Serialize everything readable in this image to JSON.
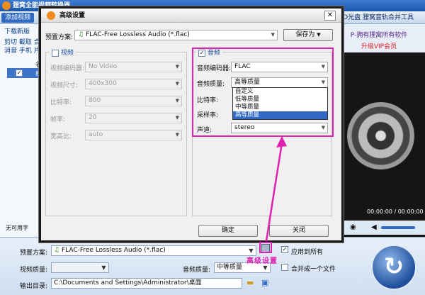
{
  "app": {
    "title": "狸窝全能视频转换器",
    "add_video": "添加视频",
    "right_toolbar": "VD光盘  狸窝音轨合并工具",
    "left_links": [
      "下载新版",
      "剪切 截取 合",
      "消音 手机 片"
    ],
    "list_header": "名",
    "list_item": "格",
    "ad_line1": "P-拥有狸窝所有软件",
    "ad_line2": "升级VIP会员",
    "time_display": "00:00:00 / 00:00:00",
    "no_subtitle": "无可用字"
  },
  "dialog": {
    "title": "高级设置",
    "preset_label": "预置方案:",
    "preset_value": "FLAC-Free Lossless Audio (*.flac)",
    "save_as": "保存为",
    "video_group": {
      "title": "视频",
      "checked": false,
      "rows": [
        {
          "label": "视频编码器:",
          "value": "No Video"
        },
        {
          "label": "视频尺寸:",
          "value": "400x300"
        },
        {
          "label": "比特率:",
          "value": "800"
        },
        {
          "label": "帧率:",
          "value": "20"
        },
        {
          "label": "宽高比:",
          "value": "auto"
        }
      ]
    },
    "audio_group": {
      "title": "音频",
      "checked": true,
      "rows": [
        {
          "label": "音频编码器:",
          "value": "FLAC"
        },
        {
          "label": "音频质量:",
          "value": "高等质量"
        },
        {
          "label": "比特率:",
          "value": ""
        },
        {
          "label": "采样率:",
          "value": ""
        },
        {
          "label": "声道:",
          "value": "stereo"
        }
      ],
      "quality_options": [
        "自定义",
        "低等质量",
        "中等质量",
        "高等质量"
      ],
      "selected_quality": "高等质量"
    },
    "ok": "确定",
    "close": "关闭"
  },
  "bottom": {
    "preset_label": "预置方案:",
    "preset_value": "FLAC-Free Lossless Audio (*.flac)",
    "apply_all": "应用到所有",
    "apply_all_checked": true,
    "video_quality_label": "视频质量:",
    "audio_quality_label": "音频质量:",
    "audio_quality_value": "中等质量",
    "merge_label": "合并成一个文件",
    "merge_checked": false,
    "output_label": "输出目录:",
    "output_value": "C:\\Documents and Settings\\Administrator\\桌面"
  },
  "annotation": {
    "text": "高级设置"
  },
  "colors": {
    "accent": "#3168c4",
    "annotation": "#e020b0"
  }
}
